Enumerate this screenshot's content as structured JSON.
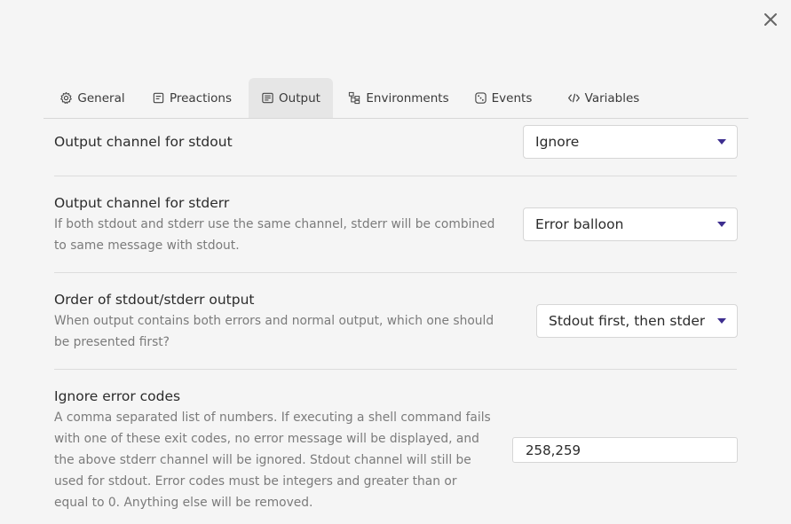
{
  "dialog": {
    "close_icon": "close-icon"
  },
  "tabs": [
    {
      "label": "General",
      "icon": "gear-icon",
      "active": false
    },
    {
      "label": "Preactions",
      "icon": "preactions-icon",
      "active": false
    },
    {
      "label": "Output",
      "icon": "output-icon",
      "active": true
    },
    {
      "label": "Environments",
      "icon": "environments-icon",
      "active": false
    },
    {
      "label": "Events",
      "icon": "events-icon",
      "active": false
    },
    {
      "label": "Variables",
      "icon": "code-icon",
      "active": false
    }
  ],
  "settings": {
    "stdout": {
      "label": "Output channel for stdout",
      "value": "Ignore"
    },
    "stderr": {
      "label": "Output channel for stderr",
      "description": "If both stdout and stderr use the same channel, stderr will be combined to same message with stdout.",
      "value": "Error balloon"
    },
    "order": {
      "label": "Order of stdout/stderr output",
      "description": "When output contains both errors and normal output, which one should be presented first?",
      "value": "Stdout first, then stderr."
    },
    "ignore_codes": {
      "label": "Ignore error codes",
      "description": "A comma separated list of numbers. If executing a shell command fails with one of these exit codes, no error message will be displayed, and the above stderr channel will be ignored. Stdout channel will still be used for stdout. Error codes must be integers and greater than or equal to 0. Anything else will be removed.",
      "value": "258,259"
    }
  },
  "colors": {
    "accent": "#3d2e8f",
    "background": "#f5f5f5",
    "active_tab": "#e6e6e6"
  }
}
